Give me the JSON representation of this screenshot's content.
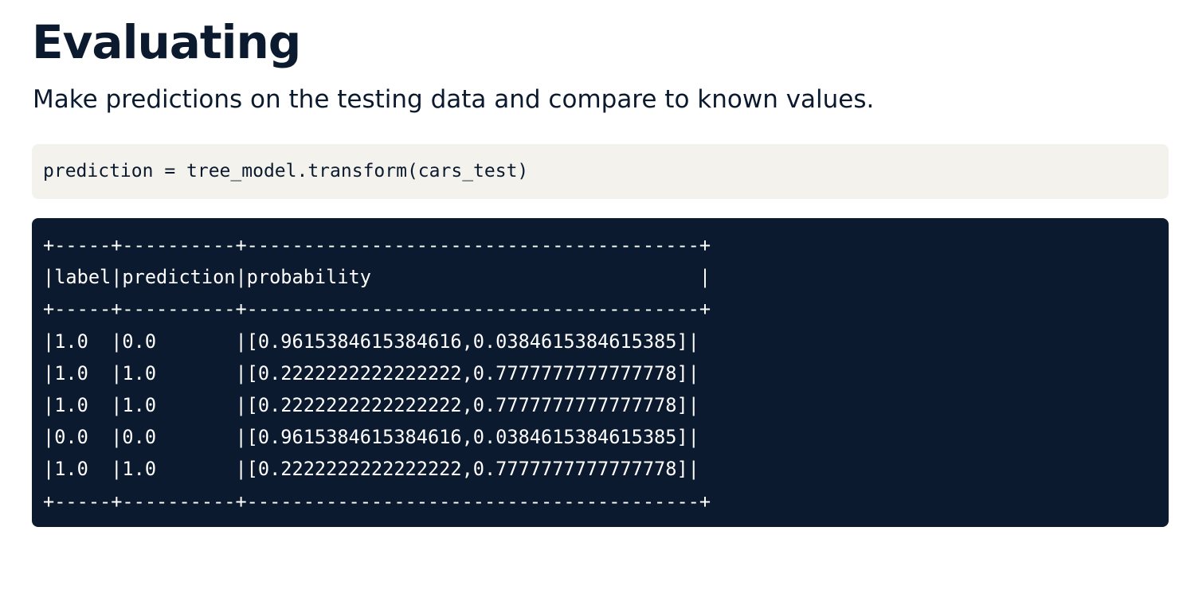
{
  "heading": "Evaluating",
  "subtitle": "Make predictions on the testing data and compare to known values.",
  "code": {
    "line": "prediction = tree_model.transform(cars_test)"
  },
  "output": {
    "lines": [
      "+-----+----------+----------------------------------------+",
      "|label|prediction|probability                             |",
      "+-----+----------+----------------------------------------+",
      "|1.0  |0.0       |[0.9615384615384616,0.0384615384615385]|",
      "|1.0  |1.0       |[0.2222222222222222,0.7777777777777778]|",
      "|1.0  |1.0       |[0.2222222222222222,0.7777777777777778]|",
      "|0.0  |0.0       |[0.9615384615384616,0.0384615384615385]|",
      "|1.0  |1.0       |[0.2222222222222222,0.7777777777777778]|",
      "+-----+----------+----------------------------------------+"
    ]
  }
}
